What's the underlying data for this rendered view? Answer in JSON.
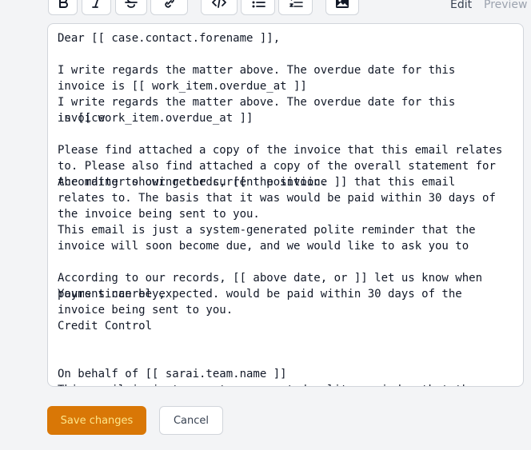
{
  "toolbar": {
    "buttons": [
      {
        "icon": "bold-icon"
      },
      {
        "icon": "italic-icon"
      },
      {
        "icon": "strikethrough-icon"
      },
      {
        "icon": "link-icon"
      },
      {
        "icon": "code-icon"
      },
      {
        "icon": "bullet-list-icon"
      },
      {
        "icon": "numbered-list-icon"
      },
      {
        "icon": "image-icon"
      }
    ],
    "edit_label": "Edit",
    "preview_label": "Preview"
  },
  "editor": {
    "text": "Dear [[ case.contact.forename ]],\n\nI write regards the matter above. The overdue date for this invoice is [[ work_item.overdue_at ]]\nI write regards the matter above. The overdue date for this invoice\n\nPlease find attached a copy of the invoice that this email relates to. Please also find attached a copy of the overall statement for the matter showing the current position.\n\n\nThis email is just a system-generated polite reminder that the invoice will soon become due, and we would like to ask you to\n\n\nYours sincerely,\n\nCredit Control",
    "ghost_1": "is [[ work_item.overdue_at ]]",
    "ghost_2": "According to our records, [[ the invoice ]] that this email relates to. The basis that it was would be paid within 30 days of the invoice being sent to you.",
    "ghost_3": "According to our records, [[ above date, or ]] let us know when payment can be expected. would be paid within 30 days of the invoice being sent to you.",
    "ghost_4": "On behalf of [[ sarai.team.name ]]\nThis email is just a system-generated polite reminder that the invoice will soon become due, and we would like to ask you to settle the invoice before the above date, or to let us know when payment can be expected."
  },
  "actions": {
    "save_label": "Save changes",
    "cancel_label": "Cancel"
  },
  "colors": {
    "accent": "#d97706",
    "border": "#d1d5db",
    "background": "#f3f4f6",
    "muted": "#9ca3af"
  }
}
